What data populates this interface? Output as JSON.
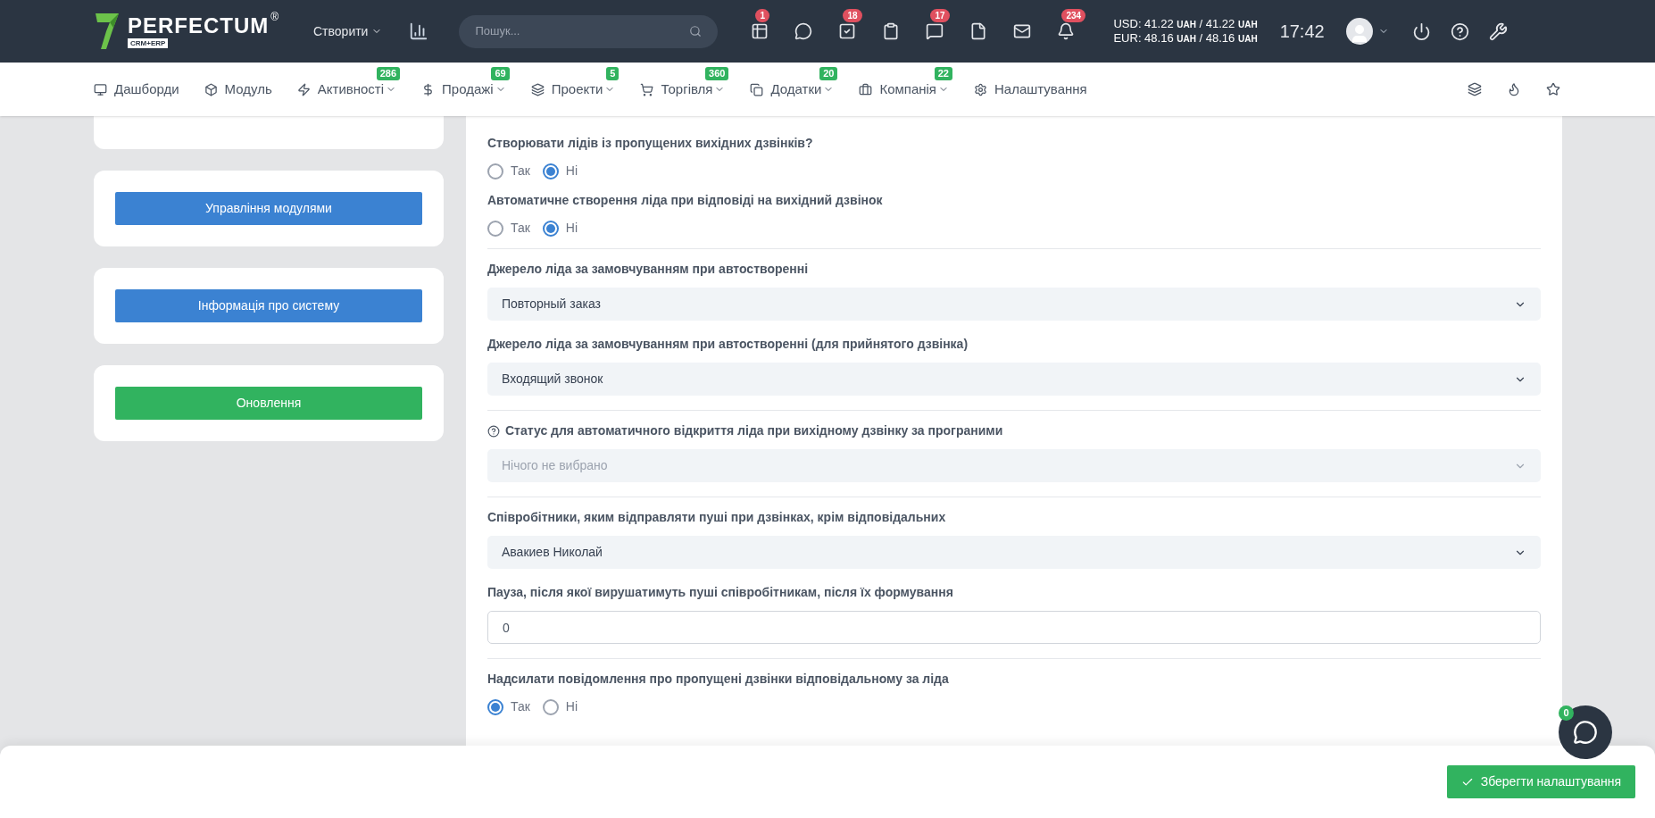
{
  "header": {
    "logo": {
      "name": "PERFECTUM",
      "mark": "®",
      "sub": "CRM+ERP"
    },
    "create_label": "Створити",
    "search": {
      "placeholder": "Пошук..."
    },
    "icons": [
      {
        "kind": "calendar",
        "badge": "1"
      },
      {
        "kind": "chat"
      },
      {
        "kind": "task",
        "badge": "18"
      },
      {
        "kind": "clipboard"
      },
      {
        "kind": "comment",
        "badge": "17"
      },
      {
        "kind": "file"
      },
      {
        "kind": "mail"
      },
      {
        "kind": "bell",
        "badge": "234"
      }
    ],
    "rates": [
      {
        "text": "USD: 41.22",
        "unit": "UAH",
        "sep": "/ 41.22",
        "unit2": "UAH"
      },
      {
        "text": "EUR: 48.16",
        "unit": "UAH",
        "sep": "/ 48.16",
        "unit2": "UAH"
      }
    ],
    "time": "17:42"
  },
  "nav": {
    "items": [
      {
        "kind": "monitor",
        "label": "Дашборди",
        "dropdown": false
      },
      {
        "kind": "box",
        "label": "Модуль",
        "dropdown": false
      },
      {
        "kind": "zap",
        "label": "Активності",
        "badge": "286",
        "dropdown": true
      },
      {
        "kind": "dollar",
        "label": "Продажі",
        "badge": "69",
        "dropdown": true
      },
      {
        "kind": "layers",
        "label": "Проекти",
        "badge": "5",
        "dropdown": true
      },
      {
        "kind": "cart",
        "label": "Торгівля",
        "badge": "360",
        "dropdown": true
      },
      {
        "kind": "copy",
        "label": "Додатки",
        "badge": "20",
        "dropdown": true
      },
      {
        "kind": "briefcase",
        "label": "Компанія",
        "badge": "22",
        "dropdown": true
      },
      {
        "kind": "settings",
        "label": "Налаштування",
        "dropdown": false
      }
    ]
  },
  "sidebar": {
    "buttons": [
      {
        "label": "Управління модулями",
        "color": "#3b82d2"
      },
      {
        "label": "Інформація про систему",
        "color": "#3b82d2"
      },
      {
        "label": "Оновлення",
        "color": "#31b35f"
      }
    ]
  },
  "settings": [
    {
      "kind": "radio",
      "label": "Створювати лідів із пропущених вихідних дзвінків?",
      "options": [
        {
          "label": "Так",
          "selected": false
        },
        {
          "label": "Ні",
          "selected": true
        }
      ]
    },
    {
      "kind": "radio",
      "label": "Автоматичне створення ліда при відповіді на вихідний дзвінок",
      "options": [
        {
          "label": "Так",
          "selected": false
        },
        {
          "label": "Ні",
          "selected": true
        }
      ]
    },
    {
      "kind": "divider"
    },
    {
      "kind": "select",
      "label": "Джерело ліда за замовчуванням при автостворенні",
      "value": "Повторный заказ"
    },
    {
      "kind": "select",
      "label": "Джерело ліда за замовчуванням при автостворенні (для прийнятого дзвінка)",
      "value": "Входящий звонок"
    },
    {
      "kind": "divider"
    },
    {
      "kind": "select",
      "label": "Статус для автоматичного відкриття ліда при вихідному дзвінку за програними",
      "help": true,
      "placeholder": "Нічого не вибрано"
    },
    {
      "kind": "divider"
    },
    {
      "kind": "select",
      "label": "Співробітники, яким відправляти пуші при дзвінках, крім відповідальних",
      "value": "Авакиев Николай"
    },
    {
      "kind": "input",
      "label": "Пауза, після якої вирушатимуть пуші співробітникам, після їх формування",
      "value": "0"
    },
    {
      "kind": "divider"
    },
    {
      "kind": "radio",
      "label": "Надсилати повідомлення про пропущені дзвінки відповідальному за ліда",
      "options": [
        {
          "label": "Так",
          "selected": true
        },
        {
          "label": "Ні",
          "selected": false
        }
      ]
    }
  ],
  "footer": {
    "save_label": "Зберегти налаштування"
  },
  "chat": {
    "badge": "0"
  }
}
